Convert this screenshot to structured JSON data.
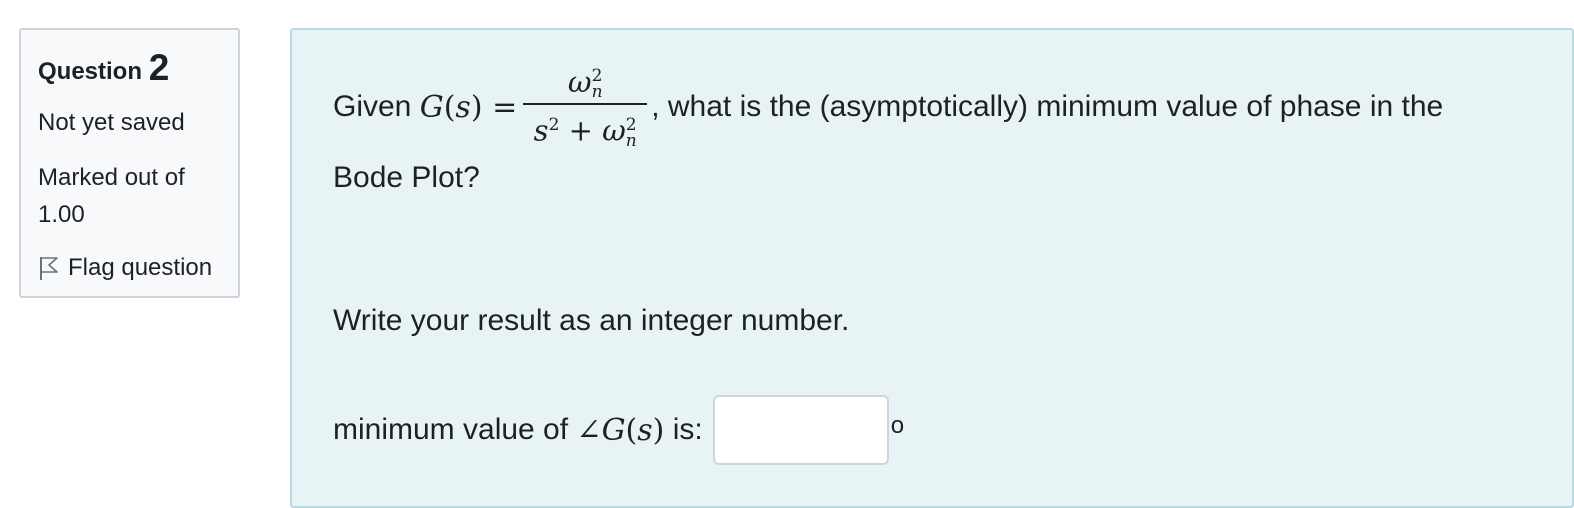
{
  "question_info": {
    "label": "Question",
    "number": "2",
    "state": "Not yet saved",
    "grade_label": "Marked out of",
    "grade_value": "1.00",
    "flag_label": "Flag question"
  },
  "question_text": {
    "given": "Given",
    "G": "G",
    "s": "s",
    "lparen": "(",
    "rparen": ")",
    "equals": "=",
    "omega": "ω",
    "n": "n",
    "exp2": "2",
    "plus": "+",
    "after_fraction": ", what is the (asymptotically) minimum value of phase in the",
    "line2": "Bode Plot?",
    "instruction": "Write your result as an integer number."
  },
  "answer": {
    "prefix": "minimum value of",
    "angle": "∠",
    "suffix": "is:",
    "value": "",
    "unit": "o"
  },
  "colors": {
    "info_bg": "#f8f9fa",
    "content_bg": "#e7f3f5",
    "content_border": "#b8dce2"
  }
}
